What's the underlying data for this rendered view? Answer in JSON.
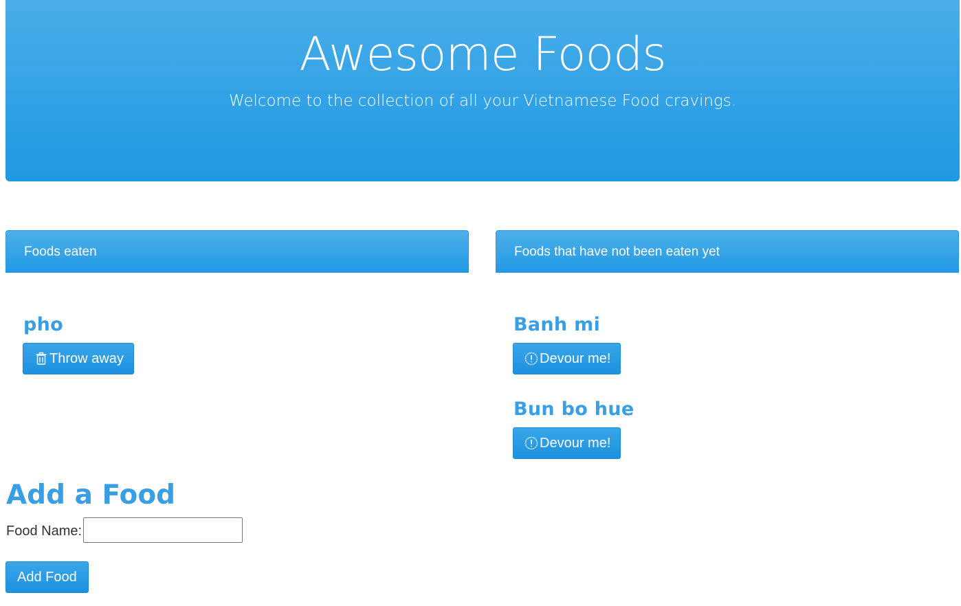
{
  "header": {
    "title": "Awesome Foods",
    "subtitle": "Welcome to the collection of all your Vietnamese Food cravings."
  },
  "eaten_panel": {
    "title": "Foods eaten",
    "items": [
      {
        "name": "pho",
        "button_label": "Throw away",
        "icon": "trash-icon"
      }
    ]
  },
  "uneaten_panel": {
    "title": "Foods that have not been eaten yet",
    "items": [
      {
        "name": "Banh mi",
        "button_label": "Devour me!",
        "icon": "exclamation-circle-icon"
      },
      {
        "name": "Bun bo hue",
        "button_label": "Devour me!",
        "icon": "exclamation-circle-icon"
      }
    ]
  },
  "add_form": {
    "title": "Add a Food",
    "label": "Food Name:",
    "input_value": "",
    "submit_label": "Add Food"
  },
  "colors": {
    "accent": "#1f98e3",
    "heading_text": "#3a9ee4"
  }
}
